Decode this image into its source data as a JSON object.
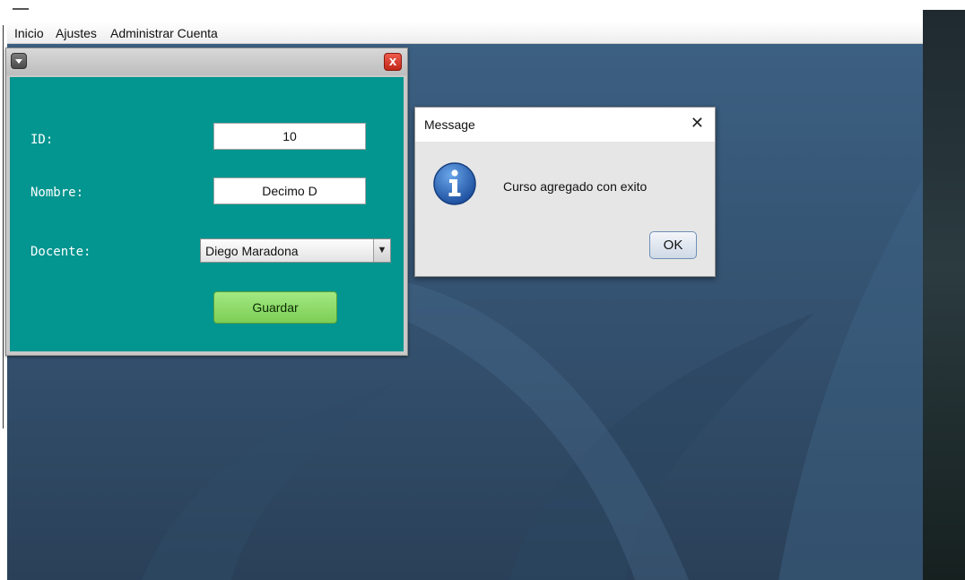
{
  "menu": {
    "items": [
      "Inicio",
      "Ajustes",
      "Administrar Cuenta"
    ]
  },
  "internal_frame": {
    "close_symbol": "x",
    "labels": {
      "id": "ID:",
      "nombre": "Nombre:",
      "docente": "Docente:"
    },
    "fields": {
      "id_value": "10",
      "nombre_value": "Decimo D",
      "docente_selected": "Diego Maradona"
    },
    "save_label": "Guardar",
    "background_color": "#03958f"
  },
  "message_dialog": {
    "title": "Message",
    "close_symbol": "✕",
    "text": "Curso agregado con exito",
    "ok_label": "OK",
    "icon": "info-icon"
  }
}
